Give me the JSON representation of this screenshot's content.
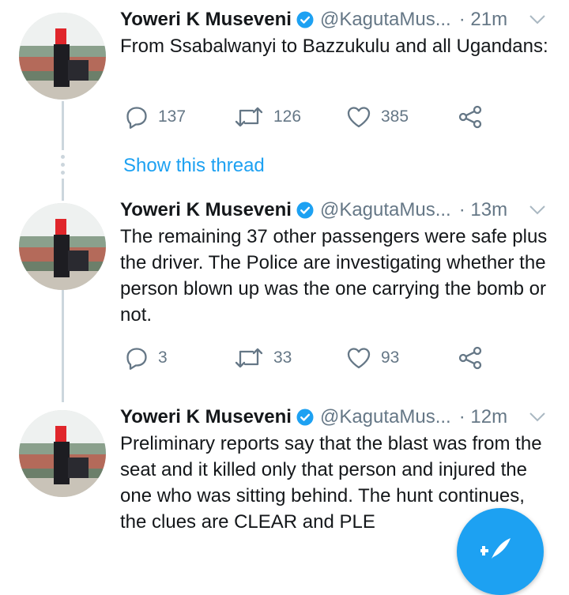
{
  "colors": {
    "accent": "#1da1f2",
    "secondary_text": "#657786",
    "thread_line": "#ccd6dd"
  },
  "show_thread_label": "Show this thread",
  "compose_button_icon": "compose-tweet-icon",
  "tweets": [
    {
      "author_name": "Yoweri K Museveni",
      "handle": "@KagutaMus...",
      "time": "· 21m",
      "text": "From Ssabalwanyi to Bazzukulu and all Ugandans:",
      "replies": "137",
      "retweets": "126",
      "likes": "385"
    },
    {
      "author_name": "Yoweri K Museveni",
      "handle": "@KagutaMus...",
      "time": "· 13m",
      "text": "The remaining 37 other passengers were safe plus the driver. The Police are investigating whether the person blown up was the one carrying the bomb or not.",
      "replies": "3",
      "retweets": "33",
      "likes": "93"
    },
    {
      "author_name": "Yoweri K Museveni",
      "handle": "@KagutaMus...",
      "time": "· 12m",
      "text": "Preliminary reports say that the blast was from the seat and it killed only that person and injured the one who was sitting behind. The hunt continues,  the clues are CLEAR and PLE",
      "replies": "",
      "retweets": "",
      "likes": ""
    }
  ]
}
